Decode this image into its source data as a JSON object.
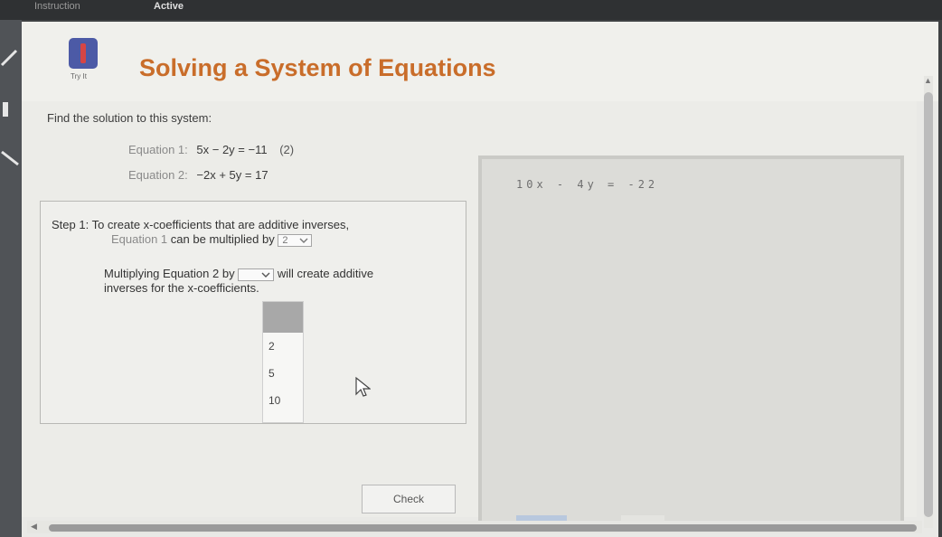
{
  "topbar": {
    "tab_instruction": "Instruction",
    "tab_active": "Active"
  },
  "header": {
    "logo_caption": "Try It",
    "title": "Solving a System of Equations"
  },
  "problem": {
    "prompt": "Find the solution to this system:",
    "equation1": {
      "name": "Equation 1:",
      "math": "5x − 2y = −11",
      "note": "(2)"
    },
    "equation2": {
      "name": "Equation 2:",
      "math": "−2x + 5y = 17"
    }
  },
  "step1": {
    "label": "Step 1:",
    "text": "To create x-coefficients that are additive inverses,",
    "line2_ref": "Equation 1",
    "line2_text": "can be multiplied by",
    "select1_value": "2",
    "line3_prefix": "Multiplying",
    "line3_ref": "Equation 2",
    "line3_by": "by",
    "select2_value": "",
    "line3_suffix": "will create additive",
    "line4": "inverses for the x-coefficients."
  },
  "dropdown": {
    "options": [
      "",
      "2",
      "5",
      "10"
    ]
  },
  "buttons": {
    "check": "Check"
  },
  "workpane": {
    "text": "10x - 4y = -22"
  }
}
